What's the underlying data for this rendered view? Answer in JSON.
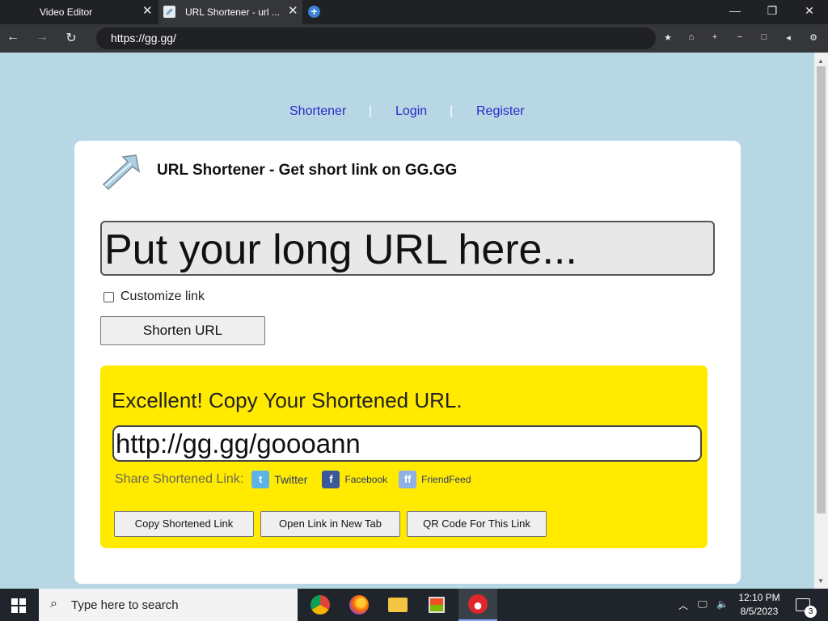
{
  "browser": {
    "tabs": [
      {
        "title": "Video Editor"
      },
      {
        "title": "URL Shortener - url ..."
      }
    ],
    "address": "https://gg.gg/"
  },
  "nav": {
    "items": [
      "Shortener",
      "Login",
      "Register"
    ],
    "separator": "|"
  },
  "card": {
    "title": "URL Shortener - Get short link on GG.GG",
    "url_placeholder": "Put your long URL here...",
    "customize_label": "Customize link",
    "shorten_label": "Shorten URL"
  },
  "result": {
    "heading": "Excellent! Copy Your Shortened URL.",
    "short_url": "http://gg.gg/goooann",
    "share_label": "Share Shortened Link:",
    "share": [
      {
        "label": "Twitter",
        "icon": "twitter-icon"
      },
      {
        "label": "Facebook",
        "icon": "facebook-icon"
      },
      {
        "label": "FriendFeed",
        "icon": "friendfeed-icon"
      }
    ],
    "buttons": {
      "copy": "Copy Shortened Link",
      "open": "Open Link in New Tab",
      "qr": "QR Code For This Link"
    }
  },
  "taskbar": {
    "search_placeholder": "Type here to search",
    "time": "12:10 PM",
    "date": "8/5/2023",
    "notification_count": "3"
  },
  "colors": {
    "page_bg": "#b7d7e5",
    "result_bg": "#ffea00",
    "nav_link": "#2a2ac8"
  }
}
